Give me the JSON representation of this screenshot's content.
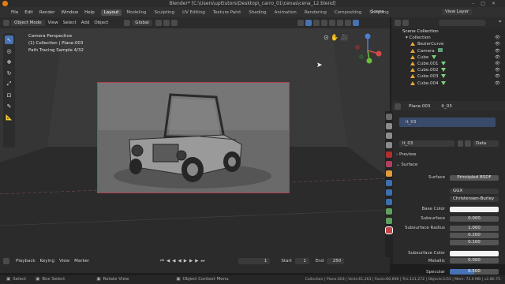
{
  "window": {
    "title": "Blender* [C:\\Users\\upttutors\\Desktop\\_carro_01\\cenas\\cena_12.blend]"
  },
  "menu": {
    "items": [
      "File",
      "Edit",
      "Render",
      "Window",
      "Help"
    ]
  },
  "workspaces": [
    "Layout",
    "Modeling",
    "Sculpting",
    "UV Editing",
    "Texture Paint",
    "Shading",
    "Animation",
    "Rendering",
    "Compositing",
    "Scripting"
  ],
  "scene": {
    "label": "Scene",
    "view_layer": "View Layer"
  },
  "viewport_header": {
    "mode": "Object Mode",
    "view": "View",
    "select": "Select",
    "add": "Add",
    "object": "Object",
    "orientation": "Global"
  },
  "overlay": {
    "line1": "Camera Perspective",
    "line2": "(1) Collection | Plane.003",
    "line3": "Path Tracing Sample 4/32"
  },
  "outliner": {
    "title": "Scene Collection",
    "items": [
      "Collection",
      "BezierCurve",
      "Camera",
      "Cube",
      "Cube.001",
      "Cube.002",
      "Cube.003",
      "Cube.004"
    ]
  },
  "properties": {
    "object_name": "Plane.003",
    "material_slot": "lt_03",
    "material_name": "lt_03",
    "data_label": "Data",
    "panel_preview": "Preview",
    "panel_surface": "Surface",
    "surface_label": "Surface",
    "surface_shader": "Principled BSDF",
    "distribution": "GGX",
    "subsurface_method": "Christensen-Burley",
    "base_color_label": "Base Color",
    "subsurface_label": "Subsurface",
    "subsurface_value": "0.000",
    "subsurface_radius_label": "Subsurface Radius",
    "radius": [
      "1.000",
      "0.200",
      "0.100"
    ],
    "subsurface_color_label": "Subsurface Color",
    "metallic_label": "Metallic",
    "metallic_value": "0.000",
    "specular_label": "Specular",
    "specular_value": "0.500"
  },
  "timeline": {
    "playback": "Playback",
    "keying": "Keying",
    "view": "View",
    "marker": "Marker",
    "current": "1",
    "start_label": "Start",
    "start": "1",
    "end_label": "End",
    "end": "250"
  },
  "statusbar": {
    "select": "Select",
    "box_select": "Box Select",
    "rotate": "Rotate View",
    "context": "Object Context Menu",
    "stats": "Collection | Plane.003 | Verts:61,263 | Faces:60,696 | Tris:121,272 | Objects:1/33 | Mem: 72.0 MB | v2.80.75"
  },
  "colors": {
    "accent": "#4772b3",
    "active_ws": "#4d4d4d",
    "render_border": "#b04050",
    "specular_bar": "#4772b3"
  }
}
